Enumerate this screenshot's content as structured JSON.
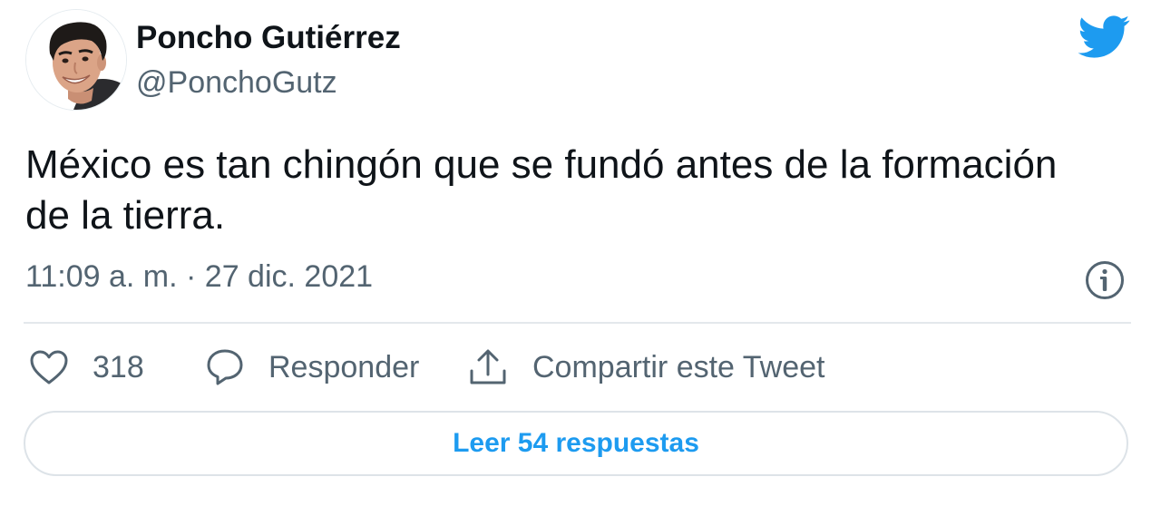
{
  "author": {
    "display_name": "Poncho Gutiérrez",
    "handle": "@PonchoGutz",
    "avatar_icon": "profile-photo"
  },
  "brand": {
    "icon": "twitter-bird-icon",
    "color": "#1d9bf0"
  },
  "tweet": {
    "text": "México es tan chingón que se fundó antes de la formación de la tierra.",
    "timestamp": "11:09 a. m. · 27 dic. 2021"
  },
  "actions": {
    "like_count": "318",
    "reply_label": "Responder",
    "share_label": "Compartir este Tweet"
  },
  "footer": {
    "read_replies_label": "Leer 54 respuestas"
  },
  "colors": {
    "text_primary": "#0f1419",
    "text_secondary": "#536471",
    "accent": "#1d9bf0",
    "divider": "#e3e8ec"
  }
}
